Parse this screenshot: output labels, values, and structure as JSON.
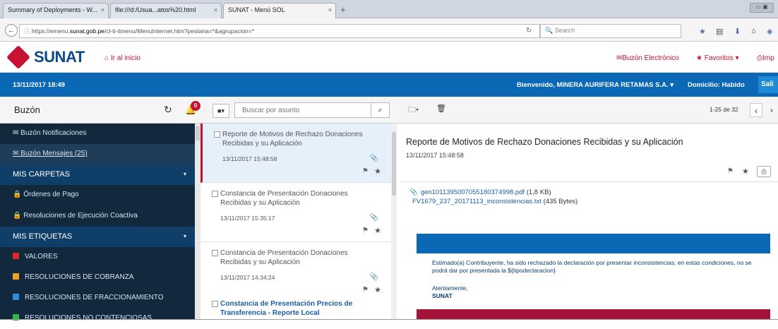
{
  "browser": {
    "tabs": [
      {
        "label": "Summary of Deployments - W..."
      },
      {
        "label": "file:///d:/Usua...atos%20.html"
      },
      {
        "label": "SUNAT - Menú SOL"
      }
    ],
    "url_prefix": "https://emenu.",
    "url_domain": "sunat.gob.pe",
    "url_rest": "/cl-ti-itmenu/MenuInternet.htm?pestana=*&agrupacion=*",
    "search_placeholder": "Search"
  },
  "header": {
    "logo_text": "SUNAT",
    "home_label": "Ir al inicio",
    "links": {
      "buzon": "Buzón Electrónico",
      "favoritos": "Favoritos",
      "imprimir": "Imp"
    }
  },
  "bluebar": {
    "datetime": "13/11/2017 18:49",
    "welcome": "Bienvenido, MINERA AURIFERA RETAMAS S.A.",
    "domicilio": "Domicilio: Habido",
    "salir": "Sali"
  },
  "toolbar": {
    "title": "Buzón",
    "badge_count": "0",
    "search_placeholder": "Buscar por asunto",
    "page_info": "1-25 de 32"
  },
  "sidebar": {
    "items": [
      {
        "label": "Buzón Notificaciones",
        "kind": "item",
        "icon": "envelope-icon"
      },
      {
        "label": "Buzón Mensajes (25)",
        "kind": "item-selected",
        "icon": "envelope-open-icon"
      },
      {
        "label": "MIS CARPETAS",
        "kind": "section"
      },
      {
        "label": "Órdenes de Pago",
        "kind": "item",
        "icon": "lock-icon"
      },
      {
        "label": "Resoluciones de Ejecución Coactiva",
        "kind": "item",
        "icon": "lock-icon"
      },
      {
        "label": "MIS ETIQUETAS",
        "kind": "section"
      },
      {
        "label": "VALORES",
        "kind": "tag",
        "color": "#e02828"
      },
      {
        "label": "RESOLUCIONES DE COBRANZA",
        "kind": "tag",
        "color": "#f0a020"
      },
      {
        "label": "RESOLUCIONES DE FRACCIONAMIENTO",
        "kind": "tag",
        "color": "#2b8de0"
      },
      {
        "label": "RESOLUCIONES NO CONTENCIOSAS",
        "kind": "tag",
        "color": "#38b24a"
      }
    ]
  },
  "messages": [
    {
      "subject": "Reporte de Motivos de Rechazo Donaciones Recibidas y su Aplicación",
      "date": "13/11/2017 15:48:58",
      "active": true,
      "unread": false
    },
    {
      "subject": "Constancia de Presentación Donaciones Recibidas y su Aplicación",
      "date": "13/11/2017 15:35:17",
      "active": false,
      "unread": false
    },
    {
      "subject": "Constancia de Presentación Donaciones Recibidas y su Aplicación",
      "date": "13/11/2017 14:34:24",
      "active": false,
      "unread": false
    },
    {
      "subject": "Constancia de Presentación Precios de Transferencia - Reporte Local",
      "date": "",
      "active": false,
      "unread": true
    }
  ],
  "reading": {
    "title": "Reporte de Motivos de Rechazo Donaciones Recibidas y su Aplicación",
    "date": "13/11/2017 15:48:58",
    "attachments": [
      {
        "name": "gen1011395007055180374998.pdf",
        "size": "(1,8 KB)"
      },
      {
        "name": "FV1679_237_20171113_inconsistencias.txt",
        "size": "(435 Bytes)"
      }
    ],
    "body_text": "Estimado(a) Contribuyente, ha sido rechazado la declaración por presentar inconsistencias; en estas condiciones, no se podrá dar por presentada la  ${tipodeclaracion}",
    "sign_1": "Atentamente,",
    "sign_2": "SUNAT"
  },
  "colors": {
    "brand_red": "#c41230",
    "brand_blue": "#0a68b4",
    "sidebar_bg": "#11283d"
  }
}
